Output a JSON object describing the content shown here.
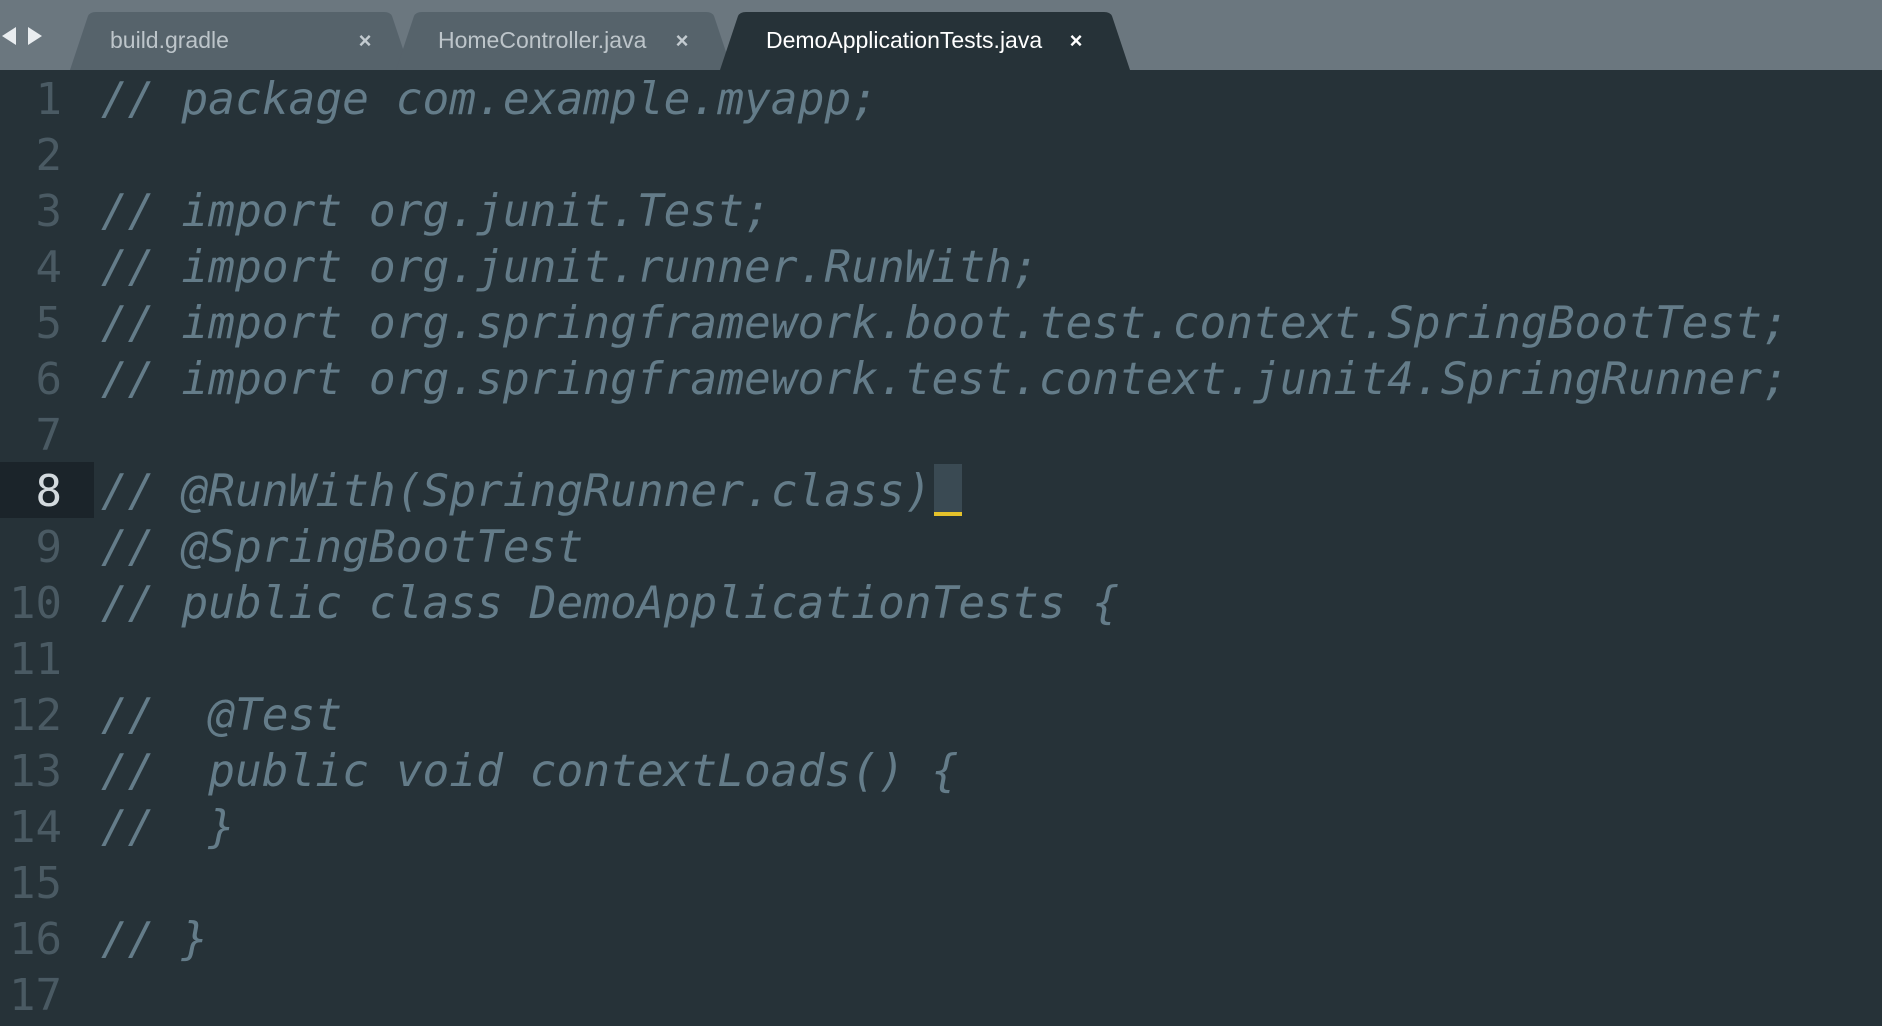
{
  "tabs": [
    {
      "label": "build.gradle",
      "close": "×",
      "active": false
    },
    {
      "label": "HomeController.java",
      "close": "×",
      "active": false
    },
    {
      "label": "DemoApplicationTests.java",
      "close": "×",
      "active": true
    }
  ],
  "editor": {
    "current_line": 8,
    "lines": [
      {
        "number": "1",
        "text": "// package com.example.myapp;"
      },
      {
        "number": "2",
        "text": ""
      },
      {
        "number": "3",
        "text": "// import org.junit.Test;"
      },
      {
        "number": "4",
        "text": "// import org.junit.runner.RunWith;"
      },
      {
        "number": "5",
        "text": "// import org.springframework.boot.test.context.SpringBootTest;"
      },
      {
        "number": "6",
        "text": "// import org.springframework.test.context.junit4.SpringRunner;"
      },
      {
        "number": "7",
        "text": ""
      },
      {
        "number": "8",
        "text": "// @RunWith(SpringRunner.class)"
      },
      {
        "number": "9",
        "text": "// @SpringBootTest"
      },
      {
        "number": "10",
        "text": "// public class DemoApplicationTests {"
      },
      {
        "number": "11",
        "text": ""
      },
      {
        "number": "12",
        "text": "//  @Test"
      },
      {
        "number": "13",
        "text": "//  public void contextLoads() {"
      },
      {
        "number": "14",
        "text": "//  }"
      },
      {
        "number": "15",
        "text": ""
      },
      {
        "number": "16",
        "text": "// }"
      },
      {
        "number": "17",
        "text": ""
      }
    ]
  },
  "colors": {
    "editor_background": "#263238",
    "tabbar_background": "#6b777f",
    "comment_text": "#647c89",
    "cursor_underline": "#e5c22b"
  }
}
